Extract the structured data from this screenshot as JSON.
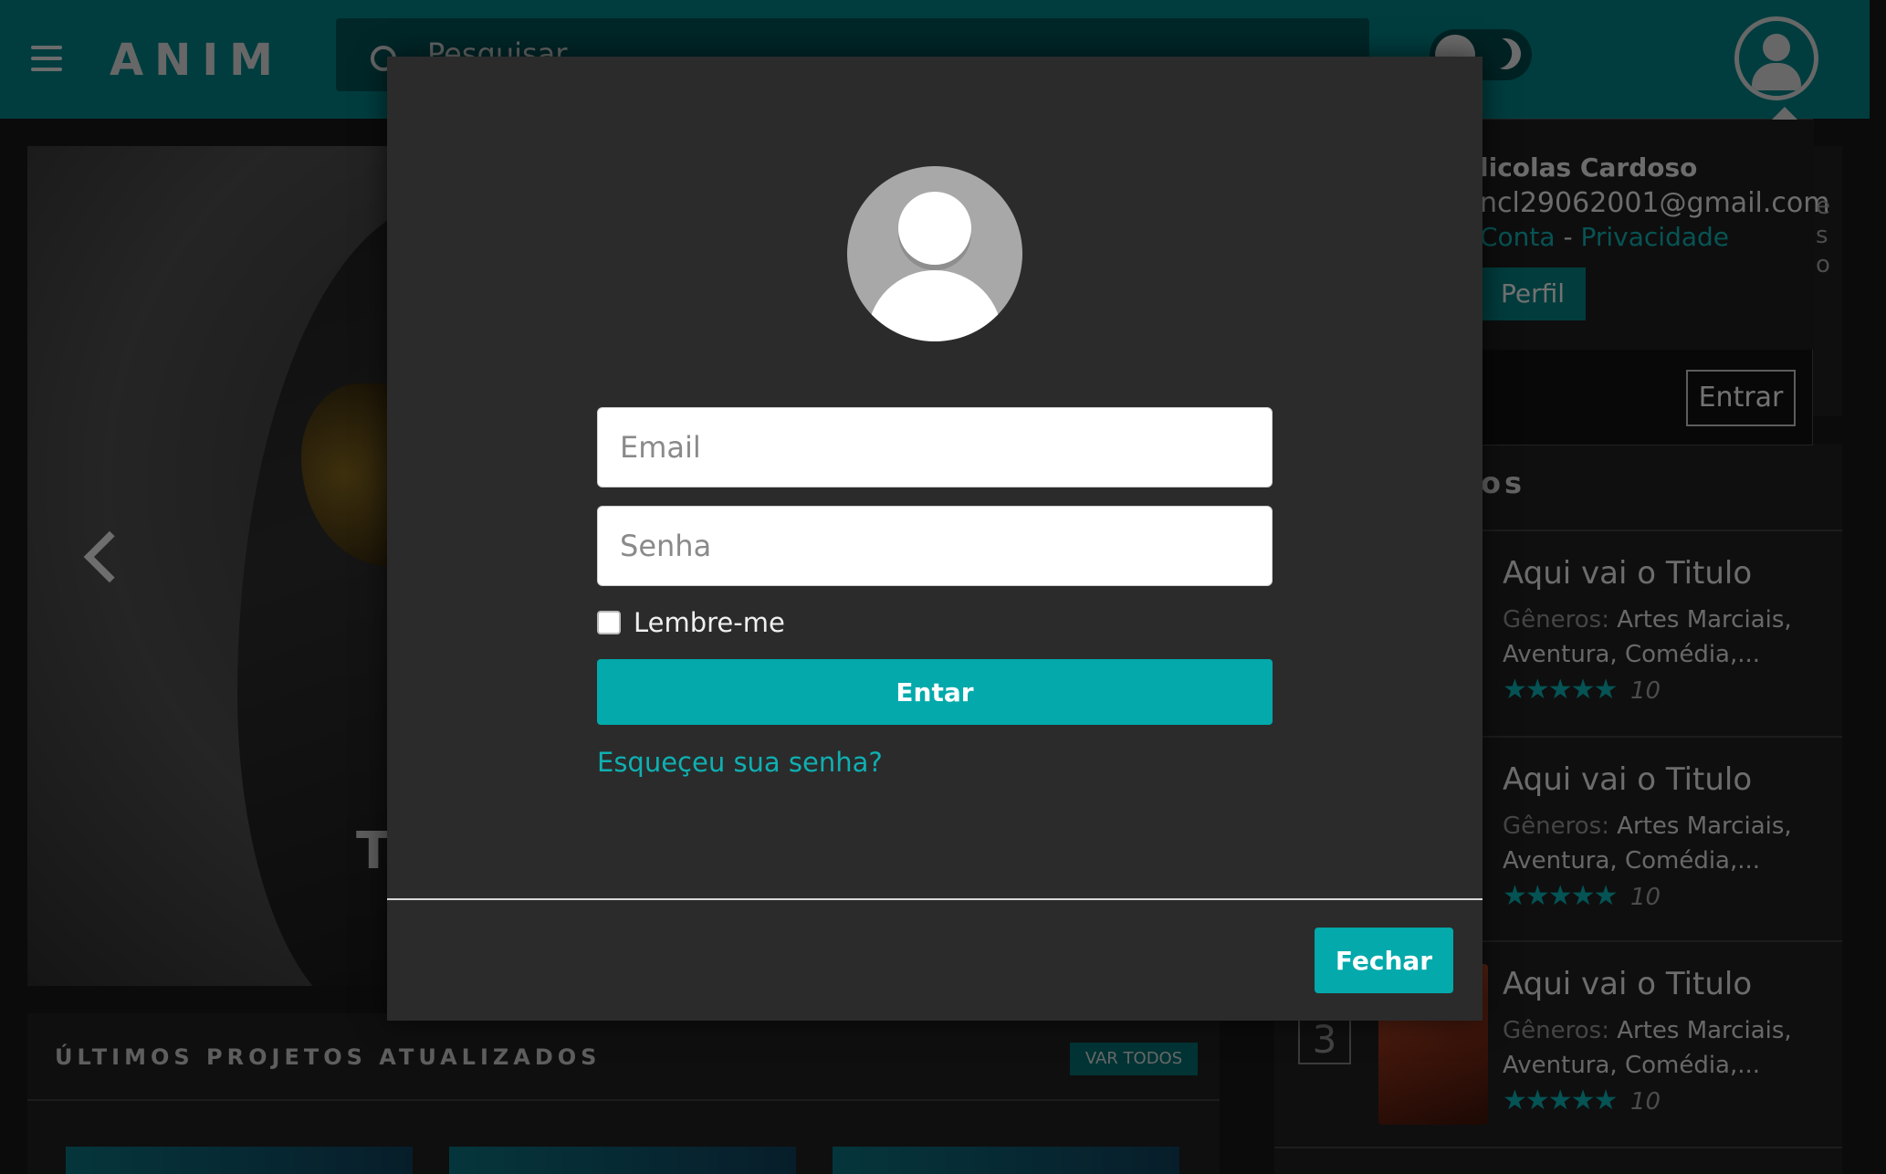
{
  "navbar": {
    "logo": "ANIM",
    "search_placeholder": "Pesquisar",
    "menu_icon": "hamburger-icon",
    "search_icon": "search-icon",
    "theme_icon": "moon-icon",
    "user_icon": "user-icon",
    "accent": "#027b7e"
  },
  "dropdown": {
    "name": "licolas Cardoso",
    "email": "ncl29062001@gmail.com",
    "link_account": "Conta",
    "separator": "-",
    "link_privacy": "Privacidade",
    "profile_button": "Perfil",
    "login_button": "Entrar",
    "right_fragments": [
      "e",
      "s",
      "o"
    ]
  },
  "slider": {
    "prev_icon": "chevron-left-icon",
    "caption_fragment": "T"
  },
  "projects": {
    "title": "ÚLTIMOS PROJETOS ATUALIZADOS",
    "view_all": "VAR TODOS"
  },
  "top_list": {
    "header_fragment": "os",
    "items": [
      {
        "rank": "",
        "title": "Aqui vai o Titulo",
        "genres_label": "Gêneros:",
        "genres": "Artes Marciais, Aventura, Comédia,...",
        "stars": "★★★★★",
        "score": "10"
      },
      {
        "rank": "",
        "title": "Aqui vai o Titulo",
        "genres_label": "Gêneros:",
        "genres": "Artes Marciais, Aventura, Comédia,...",
        "stars": "★★★★★",
        "score": "10"
      },
      {
        "rank": "3",
        "title": "Aqui vai o Titulo",
        "genres_label": "Gêneros:",
        "genres": "Artes Marciais, Aventura, Comédia,...",
        "stars": "★★★★★",
        "score": "10"
      }
    ]
  },
  "login_modal": {
    "avatar_icon": "user-avatar-icon",
    "email_placeholder": "Email",
    "email_value": "",
    "password_placeholder": "Senha",
    "password_value": "",
    "remember_label": "Lembre-me",
    "remember_checked": false,
    "submit_label": "Entar",
    "forgot_link": "Esqueçeu sua senha?",
    "close_label": "Fechar",
    "accent": "#03a9ab"
  }
}
